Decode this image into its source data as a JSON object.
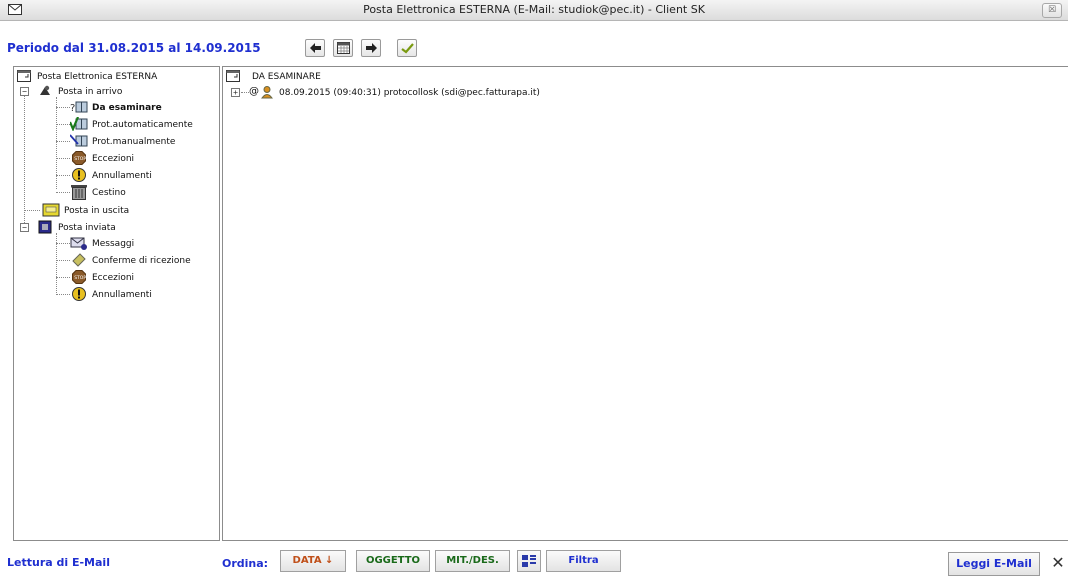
{
  "window": {
    "title": "Posta Elettronica ESTERNA (E-Mail: studiok@pec.it) - Client SK",
    "close_glyph": "☒"
  },
  "toolbar": {
    "periodo": "Periodo dal 31.08.2015 al 14.09.2015"
  },
  "tree": {
    "root": "Posta Elettronica ESTERNA",
    "posta_in_arrivo": "Posta in arrivo",
    "da_esaminare": "Da esaminare",
    "prot_auto": "Prot.automaticamente",
    "prot_man": "Prot.manualmente",
    "eccezioni_in": "Eccezioni",
    "annullamenti_in": "Annullamenti",
    "cestino": "Cestino",
    "posta_in_uscita": "Posta in uscita",
    "posta_inviata": "Posta inviata",
    "messaggi": "Messaggi",
    "conferme": "Conferme di ricezione",
    "eccezioni_out": "Eccezioni",
    "annullamenti_out": "Annullamenti"
  },
  "list": {
    "header": "DA ESAMINARE",
    "items": [
      {
        "text": "08.09.2015 (09:40:31) protocollosk (sdi@pec.fatturapa.it)"
      }
    ]
  },
  "statusbar": {
    "left": "Lettura di E-Mail",
    "ordina": "Ordina:",
    "sort_data": "DATA ↓",
    "sort_oggetto": "OGGETTO",
    "sort_mit": "MIT./DES.",
    "filtra": "Filtra",
    "leggi": "Leggi E-Mail",
    "close": "✕"
  },
  "colors": {
    "accent_blue": "#1f2fd0",
    "sort_orange": "#c0501a",
    "sort_green": "#1a6a1a"
  }
}
